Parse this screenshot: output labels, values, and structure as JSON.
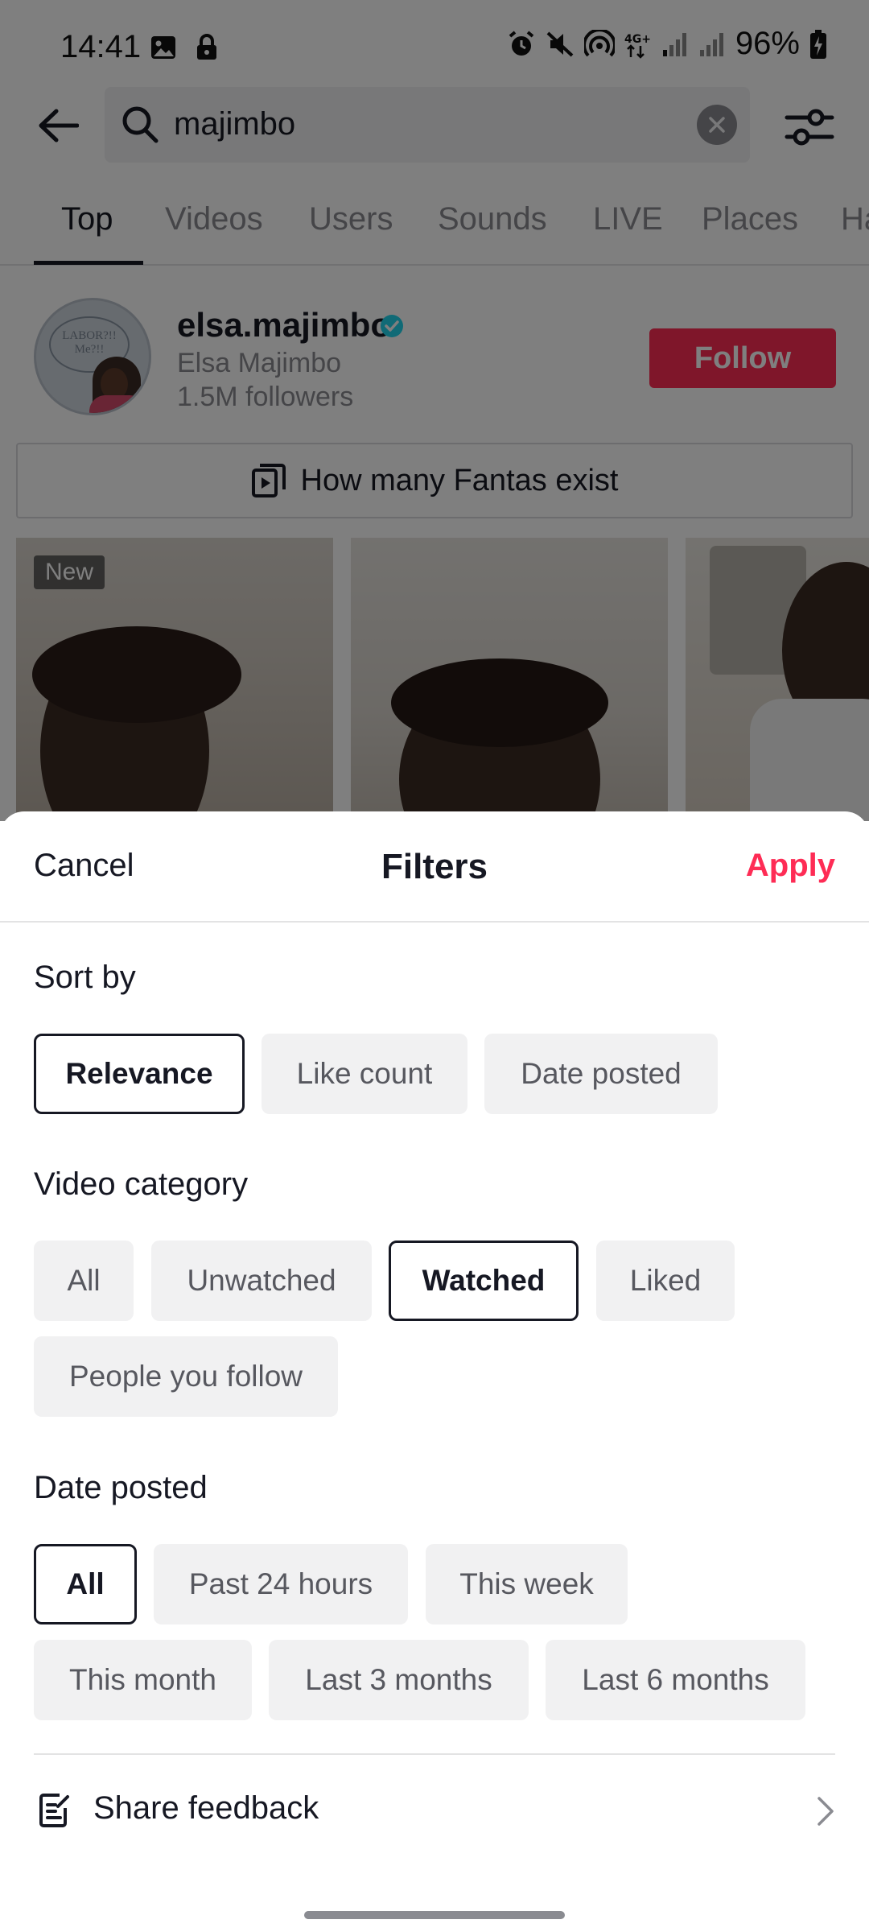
{
  "status_bar": {
    "time": "14:41",
    "battery": "96%",
    "network": "4G+"
  },
  "search": {
    "query": "majimbo"
  },
  "tabs": [
    "Top",
    "Videos",
    "Users",
    "Sounds",
    "LIVE",
    "Places",
    "Ha"
  ],
  "profile": {
    "username": "elsa.majimbo",
    "display_name": "Elsa Majimbo",
    "followers": "1.5M followers",
    "follow_label": "Follow",
    "avatar_text": "LABOR?!! Me?!!"
  },
  "related_search": "How many Fantas exist",
  "thumbnails": {
    "badge": "New"
  },
  "filters": {
    "cancel": "Cancel",
    "title": "Filters",
    "apply": "Apply",
    "sort_by": {
      "title": "Sort by",
      "options": [
        "Relevance",
        "Like count",
        "Date posted"
      ],
      "selected": "Relevance"
    },
    "video_category": {
      "title": "Video category",
      "options": [
        "All",
        "Unwatched",
        "Watched",
        "Liked",
        "People you follow"
      ],
      "selected": "Watched"
    },
    "date_posted": {
      "title": "Date posted",
      "options": [
        "All",
        "Past 24 hours",
        "This week",
        "This month",
        "Last 3 months",
        "Last 6 months"
      ],
      "selected": "All"
    },
    "feedback_label": "Share feedback"
  },
  "colors": {
    "accent": "#fe2c55",
    "verified": "#20d5ec",
    "text_primary": "#161823",
    "text_secondary": "#8a8b91",
    "chip_bg": "#f1f1f2"
  },
  "icons": [
    "back-arrow-icon",
    "search-icon",
    "clear-icon",
    "filter-sliders-icon",
    "verified-icon",
    "related-search-icon",
    "feedback-icon",
    "chevron-right-icon"
  ]
}
